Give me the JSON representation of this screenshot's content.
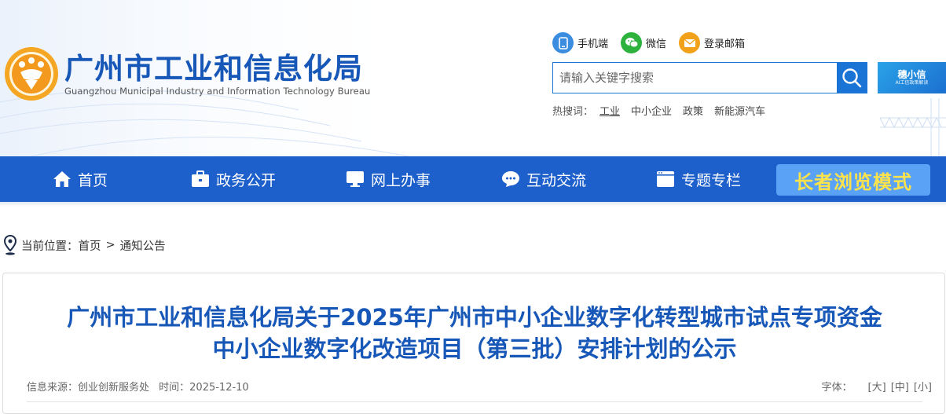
{
  "site": {
    "title_cn": "广州市工业和信息化局",
    "title_en": "Guangzhou Municipal Industry and Information Technology Bureau"
  },
  "quick_links": [
    {
      "label": "手机端",
      "icon": "mobile-icon"
    },
    {
      "label": "微信",
      "icon": "wechat-icon"
    },
    {
      "label": "登录邮箱",
      "icon": "mail-icon"
    }
  ],
  "search": {
    "placeholder": "请输入关键字搜索"
  },
  "side_badge": {
    "title": "穗小信",
    "sub": "AI工信政策解读"
  },
  "hot_words": {
    "label": "热搜词：",
    "items": [
      "工业",
      "中小企业",
      "政策",
      "新能源汽车"
    ]
  },
  "nav": {
    "items": [
      {
        "label": "首页",
        "icon": "home-icon"
      },
      {
        "label": "政务公开",
        "icon": "briefcase-icon"
      },
      {
        "label": "网上办事",
        "icon": "monitor-icon"
      },
      {
        "label": "互动交流",
        "icon": "chat-icon"
      },
      {
        "label": "专题专栏",
        "icon": "window-icon"
      }
    ],
    "elder_mode": "长者浏览模式"
  },
  "breadcrumb": {
    "label": "当前位置：",
    "home": "首页",
    "separator": ">",
    "current": "通知公告"
  },
  "article": {
    "title_line1": "广州市工业和信息化局关于2025年广州市中小企业数字化转型城市试点专项资金",
    "title_line2": "中小企业数字化改造项目（第三批）安排计划的公示",
    "source": "信息来源：创业创新服务处",
    "time": "时间：2025-12-10",
    "font_size_label": "字体：",
    "font_large": "[大]",
    "font_medium": "[中]",
    "font_small": "[小]"
  },
  "colors": {
    "brand_blue": "#1657b8",
    "nav_blue": "#1d5fcb",
    "elder_button": "#5aa2f5",
    "elder_text": "#ffe34a"
  }
}
